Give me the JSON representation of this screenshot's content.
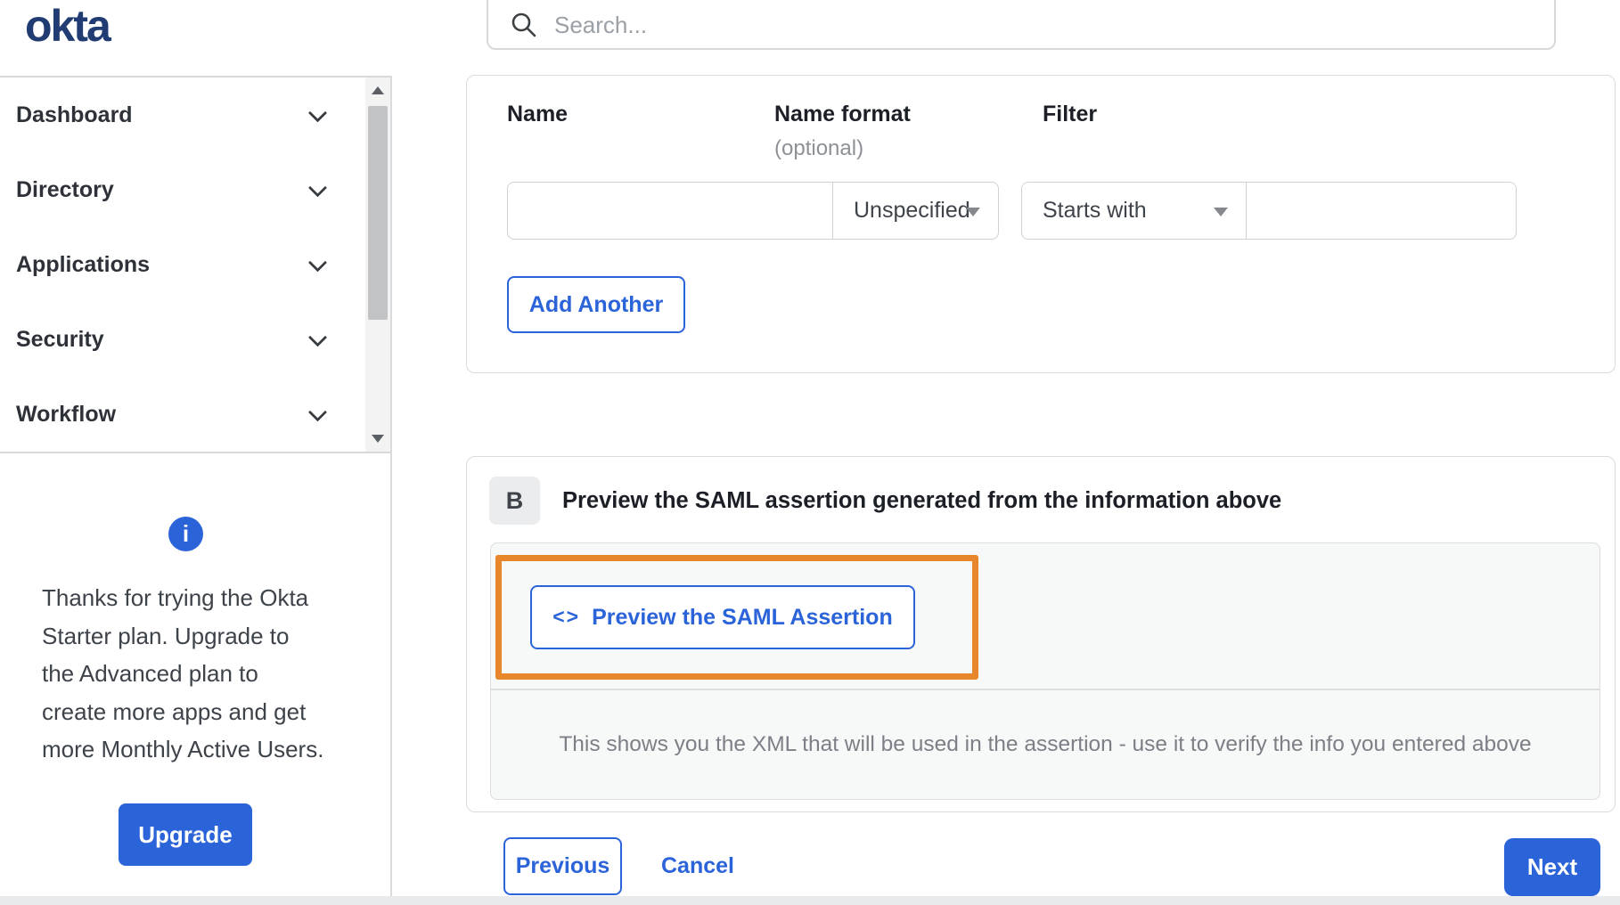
{
  "header": {
    "logo": "okta",
    "search_placeholder": "Search..."
  },
  "sidebar": {
    "items": [
      {
        "label": "Dashboard"
      },
      {
        "label": "Directory"
      },
      {
        "label": "Applications"
      },
      {
        "label": "Security"
      },
      {
        "label": "Workflow"
      }
    ],
    "upgrade_note": {
      "lines": [
        "Thanks for trying the Okta",
        "Starter plan. Upgrade to",
        "the Advanced plan to",
        "create more apps and get",
        "more Monthly Active Users."
      ],
      "button_label": "Upgrade"
    }
  },
  "form_card": {
    "name_label": "Name",
    "name_format_label": "Name format",
    "name_format_optional": "(optional)",
    "filter_label": "Filter",
    "name_value": "",
    "name_format_value": "Unspecified",
    "filter_op_value": "Starts with",
    "filter_value": "",
    "add_another_label": "Add Another"
  },
  "preview_card": {
    "badge": "B",
    "title": "Preview the SAML assertion generated from the information above",
    "code_icon": "<>",
    "preview_button_label": "Preview the SAML Assertion",
    "description": "This shows you the XML that will be used in the assertion - use it to verify the info you entered above"
  },
  "footer": {
    "previous_label": "Previous",
    "cancel_label": "Cancel",
    "next_label": "Next"
  },
  "colors": {
    "primary_blue": "#2b63d9",
    "logo_navy": "#213c72",
    "highlight_orange": "#e8862c",
    "panel_gray": "#f7f8f8",
    "border_gray": "#dadbdd"
  }
}
